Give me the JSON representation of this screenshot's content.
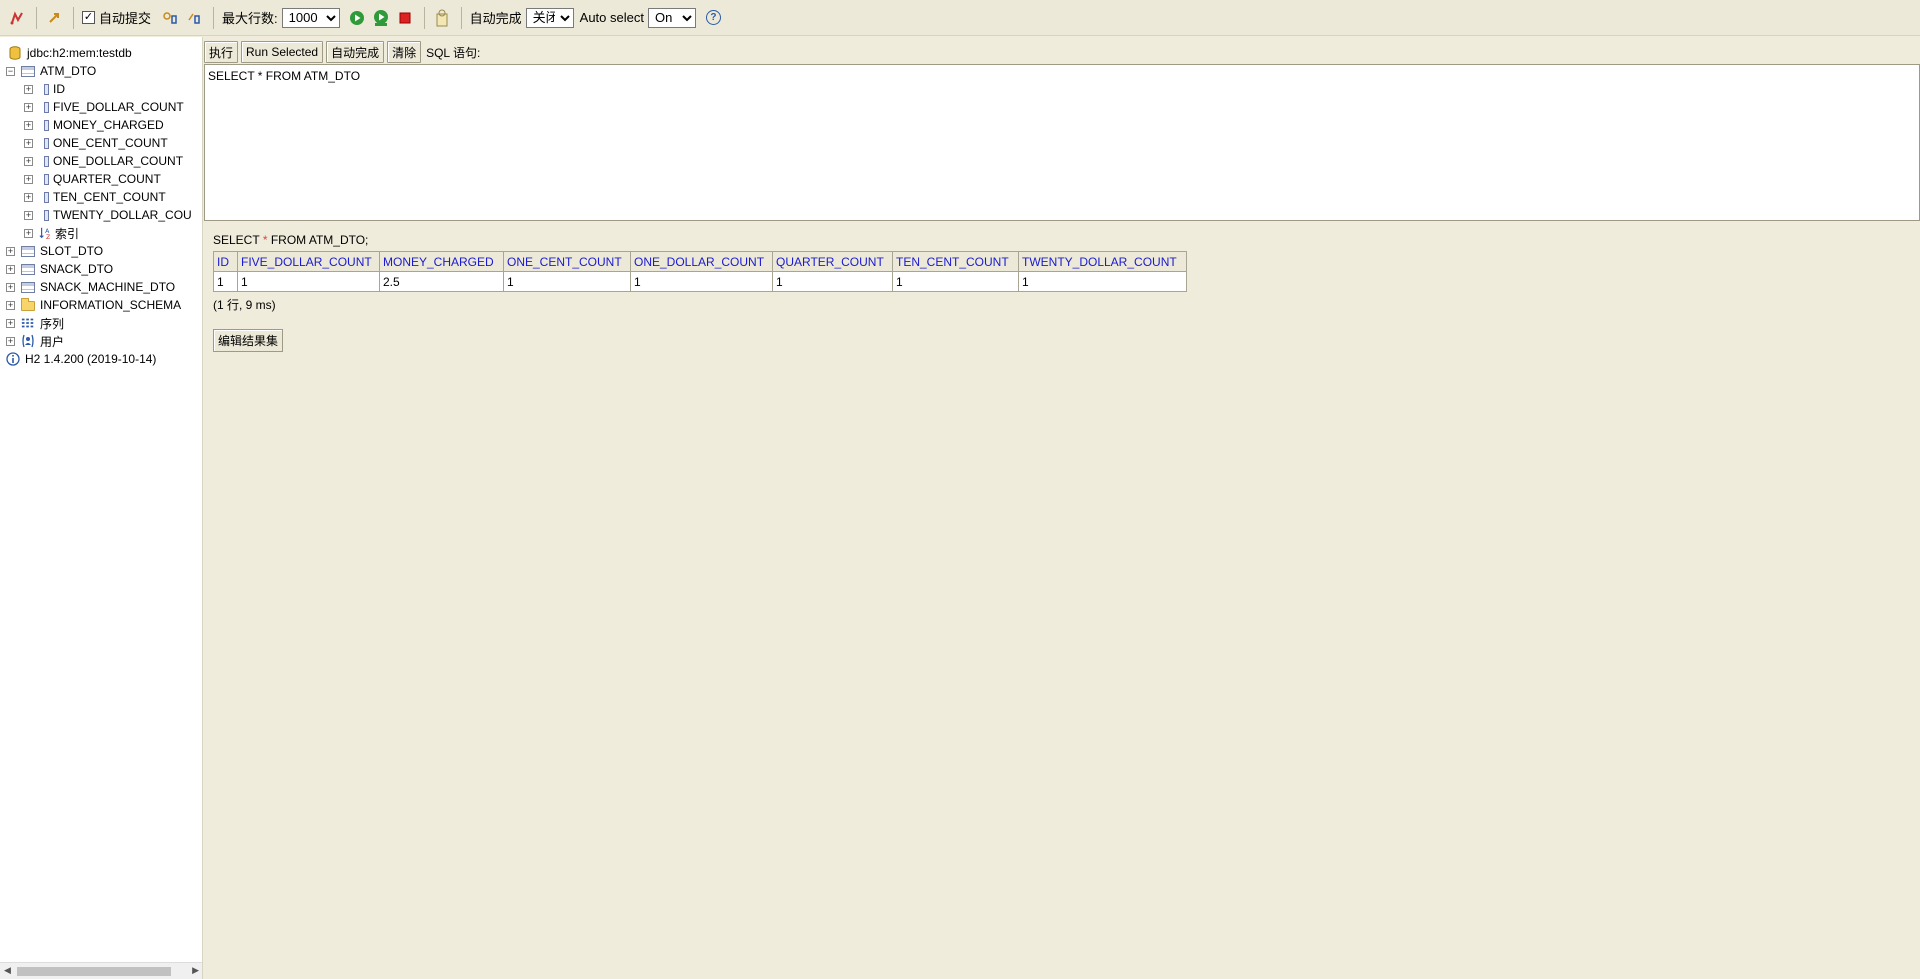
{
  "toolbar": {
    "autocommit_label": "自动提交",
    "autocommit_checked": true,
    "max_rows_label": "最大行数:",
    "max_rows_value": "1000",
    "autocomplete_label": "自动完成",
    "autocomplete_value": "关闭",
    "auto_select_label": "Auto select",
    "auto_select_value": "On",
    "help_symbol": "?"
  },
  "tree": {
    "connection": "jdbc:h2:mem:testdb",
    "tables": [
      {
        "name": "ATM_DTO",
        "expanded": true,
        "columns": [
          "ID",
          "FIVE_DOLLAR_COUNT",
          "MONEY_CHARGED",
          "ONE_CENT_COUNT",
          "ONE_DOLLAR_COUNT",
          "QUARTER_COUNT",
          "TEN_CENT_COUNT",
          "TWENTY_DOLLAR_COU"
        ],
        "indexes_label": "索引"
      },
      {
        "name": "SLOT_DTO"
      },
      {
        "name": "SNACK_DTO"
      },
      {
        "name": "SNACK_MACHINE_DTO"
      }
    ],
    "information_schema": "INFORMATION_SCHEMA",
    "sequences": "序列",
    "users": "用户",
    "version": "H2 1.4.200 (2019-10-14)"
  },
  "query": {
    "run_label": "执行",
    "run_selected_label": "Run Selected",
    "autocomplete_label": "自动完成",
    "clear_label": "清除",
    "sql_label": "SQL 语句:",
    "sql_text": "SELECT * FROM ATM_DTO"
  },
  "result": {
    "sql_prefix": "SELECT",
    "sql_star": "*",
    "sql_suffix": "FROM ATM_DTO;",
    "columns": [
      "ID",
      "FIVE_DOLLAR_COUNT",
      "MONEY_CHARGED",
      "ONE_CENT_COUNT",
      "ONE_DOLLAR_COUNT",
      "QUARTER_COUNT",
      "TEN_CENT_COUNT",
      "TWENTY_DOLLAR_COUNT"
    ],
    "rows": [
      [
        "1",
        "1",
        "2.5",
        "1",
        "1",
        "1",
        "1",
        "1"
      ]
    ],
    "meta": "(1 行, 9 ms)",
    "edit_label": "编辑结果集"
  }
}
